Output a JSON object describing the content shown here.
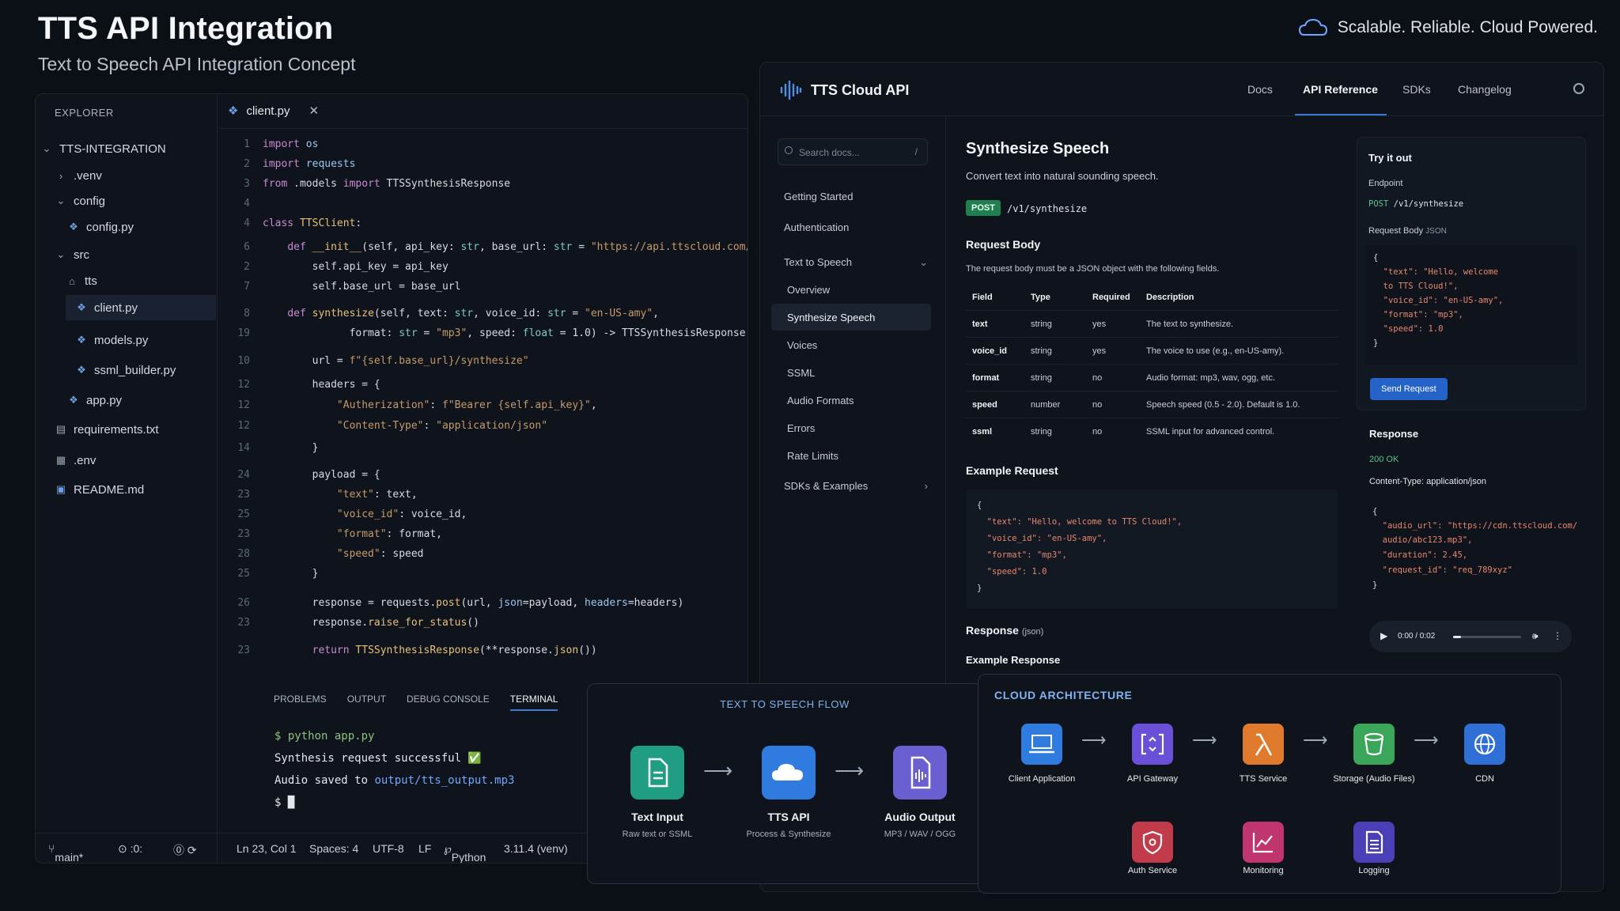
{
  "header": {
    "title": "TTS API Integration",
    "subtitle": "Text to Speech API Integration Concept",
    "tagline": "Scalable. Reliable. Cloud Powered."
  },
  "editor": {
    "explorer_title": "EXPLORER",
    "tree": [
      {
        "label": "TTS-INTEGRATION"
      },
      {
        "label": ".venv"
      },
      {
        "label": "config"
      },
      {
        "label": "config.py"
      },
      {
        "label": "src"
      },
      {
        "label": "tts"
      },
      {
        "label": "client.py"
      },
      {
        "label": "models.py"
      },
      {
        "label": "ssml_builder.py"
      },
      {
        "label": "app.py"
      },
      {
        "label": "requirements.txt"
      },
      {
        "label": ".env"
      },
      {
        "label": "README.md"
      }
    ],
    "tab": "client.py",
    "line_numbers": [
      "1",
      "2",
      "3",
      "4",
      "4",
      "6",
      "2",
      "7",
      "8",
      "19",
      "10",
      "12",
      "12",
      "12",
      "14",
      "24",
      "23",
      "25",
      "23",
      "28",
      "25",
      "26",
      "23",
      "23"
    ],
    "panel_tabs": [
      "PROBLEMS",
      "OUTPUT",
      "DEBUG CONSOLE",
      "TERMINAL"
    ],
    "terminal": {
      "cmd": "$ python app.py",
      "l1": "Synthesis request successful ✅",
      "l2a": "Audio saved to ",
      "l2b": "output/tts_output.mp3",
      "prompt": "$ █"
    },
    "status": {
      "branch": "main*",
      "sync": "⊙ :0:",
      "warn": "⓪ ⟳",
      "pos": "Ln 23, Col 1",
      "spaces": "Spaces: 4",
      "enc": "UTF-8",
      "eol": "LF",
      "lang": "Python",
      "ver": "3.11.4 (venv)"
    }
  },
  "docs": {
    "brand": "TTS Cloud API",
    "nav": [
      "Docs",
      "API Reference",
      "SDKs",
      "Changelog"
    ],
    "search_placeholder": "Search docs...",
    "search_key": "/",
    "side": [
      "Getting Started",
      "Authentication",
      "Text to Speech",
      "Overview",
      "Synthesize Speech",
      "Voices",
      "SSML",
      "Audio Formats",
      "Errors",
      "Rate Limits",
      "SDKs & Examples"
    ],
    "title": "Synthesize Speech",
    "desc": "Convert text into natural sounding speech.",
    "method": "POST",
    "endpoint": "/v1/synthesize",
    "req_body_h": "Request Body",
    "req_body_p": "The request body must be a JSON object with the following fields.",
    "cols": [
      "Field",
      "Type",
      "Required",
      "Description"
    ],
    "rows": [
      [
        "text",
        "string",
        "yes",
        "The text to synthesize."
      ],
      [
        "voice_id",
        "string",
        "yes",
        "The voice to use (e.g., en-US-amy)."
      ],
      [
        "format",
        "string",
        "no",
        "Audio format: mp3, wav, ogg, etc."
      ],
      [
        "speed",
        "number",
        "no",
        "Speech speed (0.5 - 2.0). Default is 1.0."
      ],
      [
        "ssml",
        "string",
        "no",
        "SSML input for advanced control."
      ]
    ],
    "example_req_h": "Example Request",
    "example_req": [
      "{",
      "  \"text\": \"Hello, welcome to TTS Cloud!\",",
      "  \"voice_id\": \"en-US-amy\",",
      "  \"format\": \"mp3\",",
      "  \"speed\": 1.0",
      "}"
    ],
    "response_h": "Response",
    "response_suffix": "(json)",
    "example_resp_h": "Example Response",
    "try": {
      "title": "Try it out",
      "endpoint_label": "Endpoint",
      "method": "POST",
      "path": "/v1/synthesize",
      "body_label": "Request Body",
      "body_suffix": "JSON",
      "body": [
        "{",
        "  \"text\": \"Hello, welcome",
        "  to TTS Cloud!\",",
        "  \"voice_id\": \"en-US-amy\",",
        "  \"format\": \"mp3\",",
        "  \"speed\": 1.0",
        "}"
      ],
      "send": "Send Request"
    },
    "resp": {
      "title": "Response",
      "status": "200 OK",
      "ctype": "Content-Type: application/json",
      "body": [
        "{",
        "  \"audio_url\": \"https://cdn.ttscloud.com/",
        "  audio/abc123.mp3\",",
        "  \"duration\": 2.45,",
        "  \"request_id\": \"req_789xyz\"",
        "}"
      ],
      "time": "0:00 / 0:02",
      "progress": 0.12
    }
  },
  "flow": {
    "title": "TEXT TO SPEECH FLOW",
    "nodes": [
      {
        "label": "Text Input",
        "sub": "Raw text or SSML",
        "color": "#1f9e84",
        "icon": "document-icon"
      },
      {
        "label": "TTS API",
        "sub": "Process & Synthesize",
        "color": "#2f7be0",
        "icon": "cloud-icon"
      },
      {
        "label": "Audio Output",
        "sub": "MP3 / WAV / OGG",
        "color": "#6a5fd0",
        "icon": "audio-file-icon"
      }
    ]
  },
  "arch": {
    "title": "CLOUD ARCHITECTURE",
    "nodes": [
      {
        "label": "Client Application",
        "color": "#2f7be0",
        "icon": "laptop-icon"
      },
      {
        "label": "API Gateway",
        "color": "#6a4fd8",
        "icon": "gateway-icon"
      },
      {
        "label": "TTS Service",
        "color": "#e07a2c",
        "icon": "lambda-icon"
      },
      {
        "label": "Storage (Audio Files)",
        "color": "#3aa65a",
        "icon": "bucket-icon"
      },
      {
        "label": "CDN",
        "color": "#2f6fd6",
        "icon": "globe-icon"
      },
      {
        "label": "Auth Service",
        "color": "#c23b4a",
        "icon": "shield-icon"
      },
      {
        "label": "Monitoring",
        "color": "#c0356e",
        "icon": "chart-icon"
      },
      {
        "label": "Logging",
        "color": "#4b3fb8",
        "icon": "log-icon"
      }
    ]
  }
}
